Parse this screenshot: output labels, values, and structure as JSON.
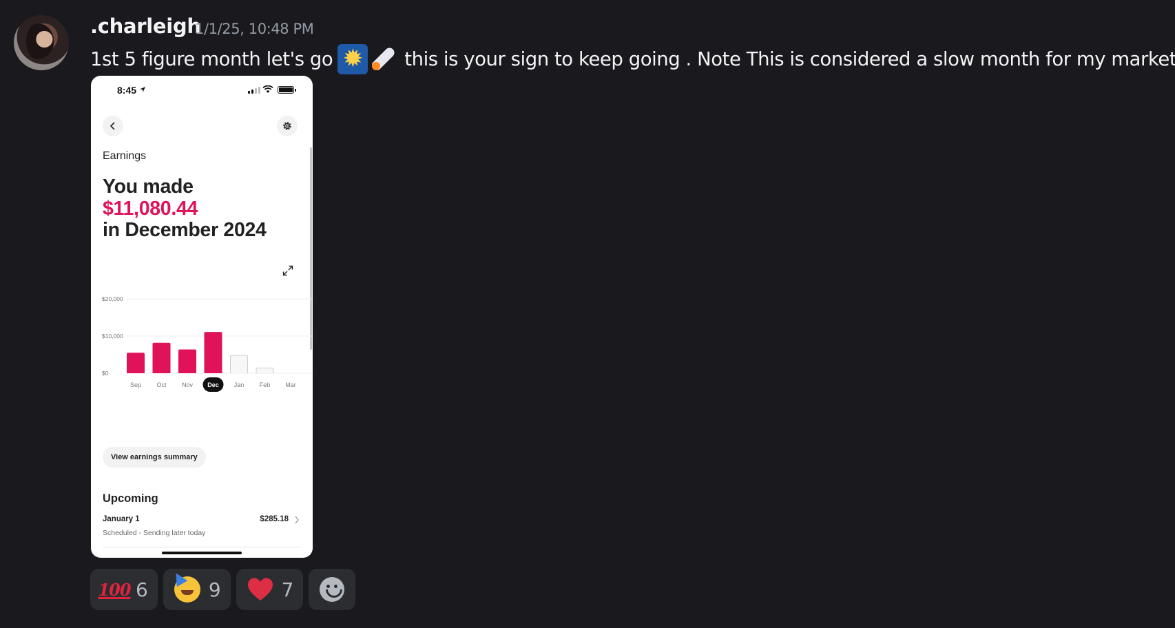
{
  "message": {
    "author": ".charleigh",
    "timestamp": "1/1/25, 10:48 PM",
    "text_part1": "1st 5 figure month let's go",
    "text_part2": "this is your sign to keep going . Note This is considered a slow month for my market",
    "emojis": [
      "sparkle-icon",
      "rocket-icon"
    ]
  },
  "attachment": {
    "status_time": "8:45",
    "section_label": "Earnings",
    "headline_line1": "You made",
    "headline_amount": "$11,080.44",
    "headline_line3": "in December 2024",
    "summary_button": "View earnings summary",
    "upcoming_title": "Upcoming",
    "payout": {
      "date": "January 1",
      "amount": "$285.18",
      "status": "Scheduled - Sending later today"
    },
    "colors": {
      "accent": "#e0135a"
    }
  },
  "chart_data": {
    "type": "bar",
    "categories": [
      "Sep",
      "Oct",
      "Nov",
      "Dec",
      "Jan",
      "Feb",
      "Mar"
    ],
    "values": [
      5500,
      8200,
      6400,
      11080.44,
      4900,
      1500,
      0
    ],
    "paid": [
      true,
      true,
      true,
      true,
      false,
      false,
      false
    ],
    "selected": "Dec",
    "y_ticks": [
      "$20,000",
      "$10,000",
      "$0"
    ],
    "y_tick_values": [
      20000,
      10000,
      0
    ],
    "ylim": [
      0,
      20000
    ],
    "title": "",
    "xlabel": "",
    "ylabel": ""
  },
  "reactions": [
    {
      "emoji": "hundred-points",
      "glyph": "100",
      "count": "6"
    },
    {
      "emoji": "partying-face",
      "count": "9"
    },
    {
      "emoji": "red-heart",
      "count": "7"
    }
  ]
}
